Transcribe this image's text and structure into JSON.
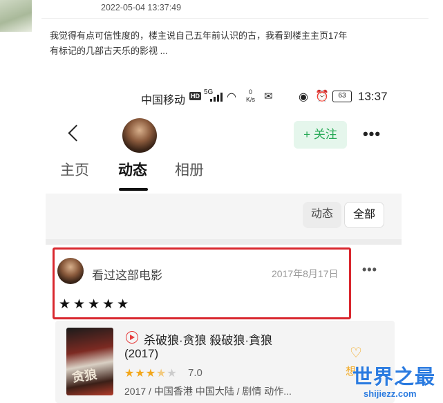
{
  "forum": {
    "date": "2022-05-04 13:37:49",
    "comment": "我觉得有点可信性度的，楼主说自己五年前认识的古，我看到楼主主页17年有标记的几部古天乐的影视 ..."
  },
  "status_bar": {
    "carrier": "中国移动",
    "hd": "HD",
    "signal": "5G",
    "speed_value": "0",
    "speed_unit": "K/s",
    "battery": "63",
    "time": "13:37"
  },
  "profile_nav": {
    "follow_label": "+ 关注",
    "more_label": "•••"
  },
  "tabs": [
    {
      "label": "主页",
      "active": false
    },
    {
      "label": "动态",
      "active": true
    },
    {
      "label": "相册",
      "active": false
    }
  ],
  "filters": {
    "dongtai": "动态",
    "all": "全部"
  },
  "post": {
    "action": "看过这部电影",
    "date": "2017年8月17日",
    "stars": "★★★★★",
    "more_label": "•••"
  },
  "movie": {
    "title": "杀破狼·贪狼 殺破狼·貪狼",
    "year": "(2017)",
    "stars_on": "★★★",
    "stars_half": "★",
    "stars_off": "★",
    "score": "7.0",
    "meta": "2017 / 中国香港 中国大陆 / 剧情 动作...",
    "poster_text": "贪狼",
    "want_label": "想"
  },
  "watermark": {
    "title": "世界之最",
    "url": "shijiezz.com"
  },
  "colors": {
    "highlight_border": "#d9272e",
    "follow_green": "#27a956",
    "star_gold": "#f2a71c",
    "watermark_blue": "#2b7be0"
  },
  "icons": {
    "back": "back-chevron-icon",
    "play": "play-circle-icon",
    "want": "heart-plus-icon",
    "wifi": "wifi-icon",
    "wechat": "wechat-icon",
    "eye": "eye-icon",
    "alarm": "alarm-icon"
  }
}
